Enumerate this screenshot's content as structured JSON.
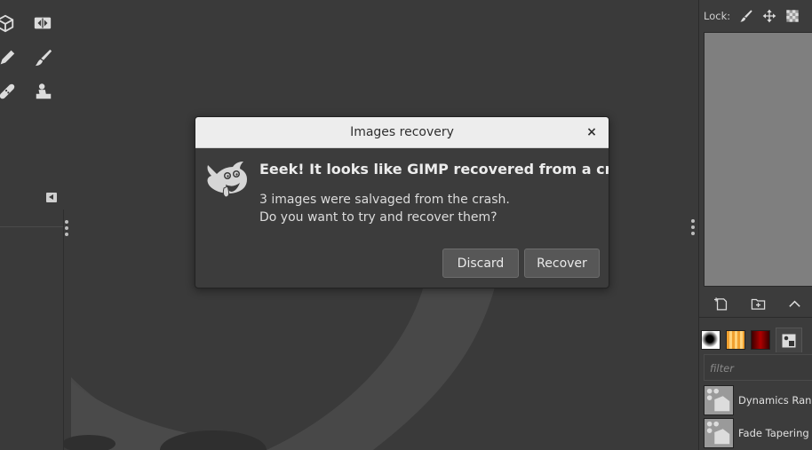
{
  "dialog": {
    "title": "Images recovery",
    "close_glyph": "×",
    "headline": "Eeek! It looks like GIMP recovered from a crash!",
    "body": "3 images were salvaged from the crash. Do you want to try and recover them?",
    "discard_label": "Discard",
    "recover_label": "Recover",
    "icon": "wilber-icon"
  },
  "layers_dock": {
    "lock_label": "Lock:",
    "lock_icons": [
      "paintbrush-lock-icon",
      "move-lock-icon",
      "alpha-lock-icon"
    ],
    "buttons": [
      "new-layer-icon",
      "new-layer-group-icon",
      "raise-layer-icon"
    ]
  },
  "brushes_dock": {
    "tabs": [
      "brush-tab-icon",
      "pattern-tab-icon",
      "gradient-tab-icon",
      "paint-dynamics-tab-icon"
    ],
    "filter_placeholder": "filter",
    "items": [
      {
        "name": "Dynamics Random"
      },
      {
        "name": "Fade Tapering"
      }
    ]
  },
  "toolbox": {
    "tools": [
      "3d-transform-icon",
      "flip-icon",
      "pencil-icon",
      "paintbrush-icon",
      "heal-icon",
      "clone-icon"
    ]
  },
  "colors": {
    "canvas": "#3a3a3a",
    "dialog_bg": "#3c3c3c",
    "titlebar": "#ededed",
    "button": "#575757"
  }
}
